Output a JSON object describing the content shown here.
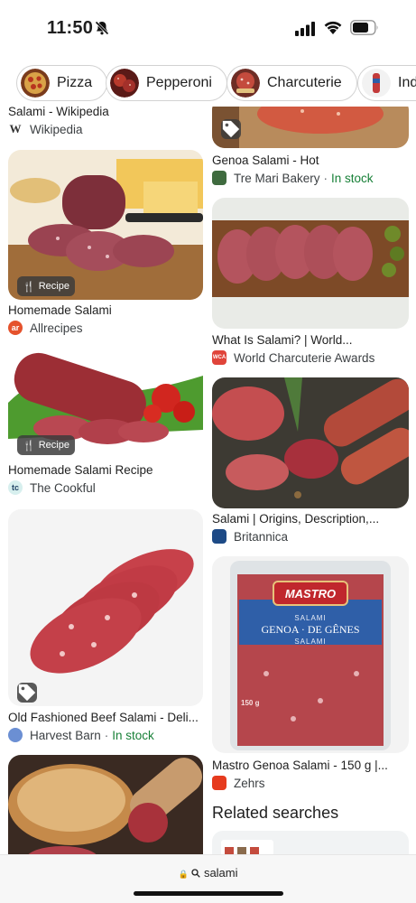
{
  "status_bar": {
    "time": "11:50"
  },
  "chips": [
    {
      "label": "Pizza"
    },
    {
      "label": "Pepperoni"
    },
    {
      "label": "Charcuterie"
    },
    {
      "label": "Indu"
    }
  ],
  "results": {
    "left": [
      {
        "title": "Salami - Wikipedia",
        "source": "Wikipedia",
        "favicon": "W"
      },
      {
        "title": "Homemade Salami",
        "source": "Allrecipes",
        "favicon": "ar",
        "badge": "Recipe"
      },
      {
        "title": "Homemade Salami Recipe",
        "source": "The Cookful",
        "favicon": "tc",
        "badge": "Recipe"
      },
      {
        "title": "Old Fashioned Beef Salami - Deli...",
        "source": "Harvest Barn",
        "stock": "In stock"
      },
      {
        "title": "",
        "source": ""
      }
    ],
    "right": [
      {
        "title": "Genoa Salami - Hot",
        "source": "Tre Mari Bakery",
        "stock": "In stock"
      },
      {
        "title": "What Is Salami? | World...",
        "source": "World Charcuterie Awards",
        "favicon": "WCA"
      },
      {
        "title": "Salami | Origins, Description,...",
        "source": "Britannica"
      },
      {
        "title": "Mastro Genoa Salami - 150 g |...",
        "source": "Zehrs"
      }
    ]
  },
  "package": {
    "brand": "MASTRO",
    "line1": "SALAMI",
    "line2": "GENOA · DE GÊNES",
    "line3": "SALAMI",
    "weight": "150 g"
  },
  "related": {
    "title": "Related searches"
  },
  "address_bar": {
    "lock": "🔒",
    "query": "salami"
  },
  "colors": {
    "in_stock": "#188038",
    "chip_border": "#d2d2d2"
  }
}
